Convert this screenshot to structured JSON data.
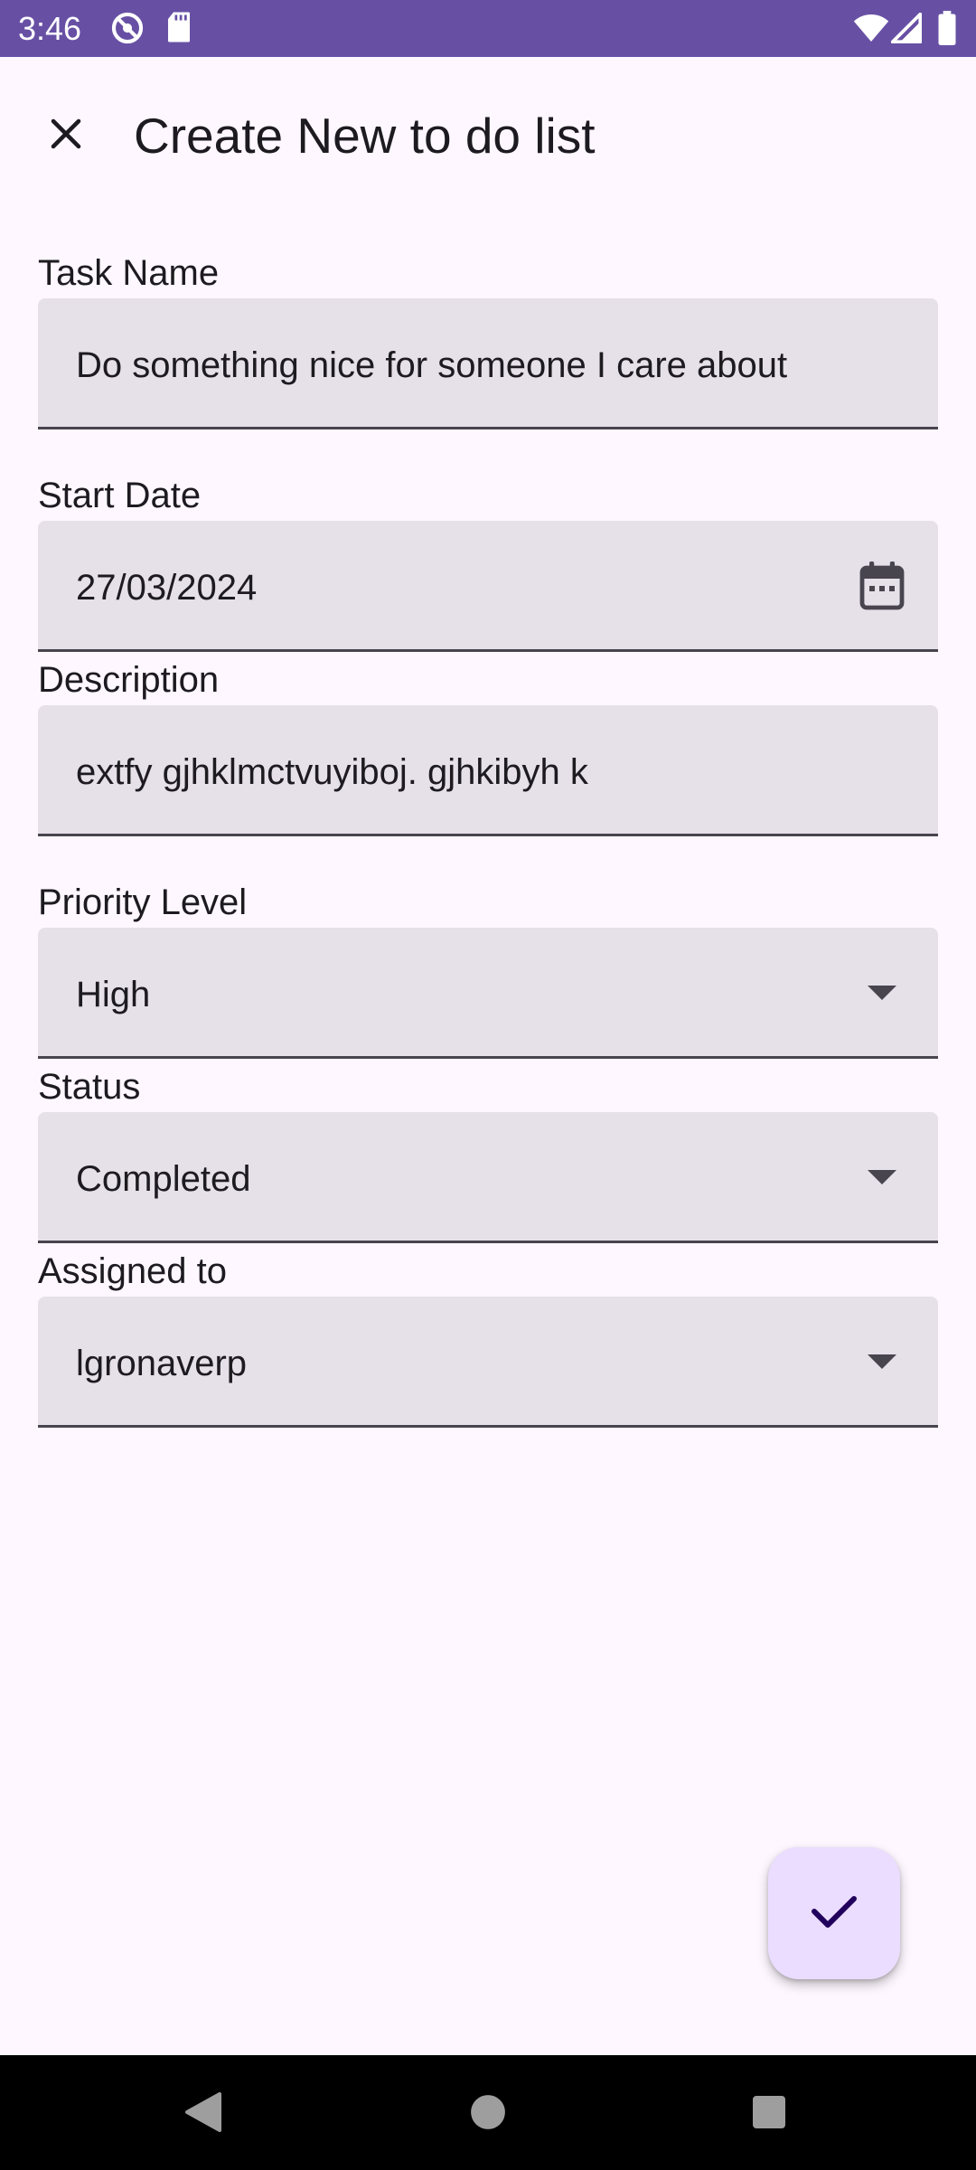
{
  "status_bar": {
    "time": "3:46",
    "icons": [
      "do-not-disturb-icon",
      "sd-card-icon",
      "wifi-icon",
      "signal-icon",
      "battery-icon"
    ]
  },
  "app_bar": {
    "close_icon": "close-icon",
    "title": "Create New to do list"
  },
  "form": {
    "task_name": {
      "label": "Task Name",
      "value": "Do something nice for someone I care about"
    },
    "start_date": {
      "label": "Start Date",
      "value": "27/03/2024",
      "icon": "calendar-icon"
    },
    "description": {
      "label": "Description",
      "value": "extfy gjhklmctvuyiboj. gjhkibyh k"
    },
    "priority": {
      "label": "Priority Level",
      "value": "High",
      "icon": "dropdown-arrow-icon"
    },
    "status": {
      "label": "Status",
      "value": "Completed",
      "icon": "dropdown-arrow-icon"
    },
    "assigned_to": {
      "label": "Assigned to",
      "value": "lgronaverp",
      "icon": "dropdown-arrow-icon"
    }
  },
  "fab": {
    "icon": "check-icon"
  },
  "nav_bar": {
    "buttons": [
      "back-icon",
      "home-icon",
      "recents-icon"
    ]
  },
  "colors": {
    "status_bar": "#6750A4",
    "background": "#FEF7FF",
    "field_fill": "#E6E0E9",
    "field_underline": "#49454F",
    "fab_fill": "#EADDFF",
    "fab_icon": "#21005D",
    "text": "#1D1B20"
  }
}
